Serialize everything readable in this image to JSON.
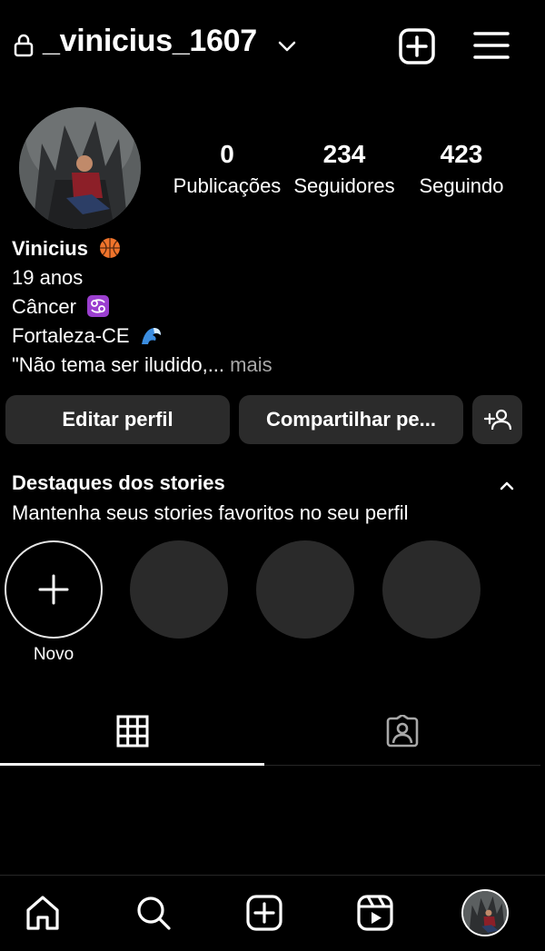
{
  "header": {
    "username": "_vinicius_1607",
    "icons": [
      "lock-icon",
      "chevron-down-icon",
      "create-post-icon",
      "menu-icon"
    ]
  },
  "stats": {
    "posts": {
      "count": "0",
      "label": "Publicações"
    },
    "followers": {
      "count": "234",
      "label": "Seguidores"
    },
    "following": {
      "count": "423",
      "label": "Seguindo"
    }
  },
  "bio": {
    "name": "Vinicius",
    "name_emoji": "basketball-icon",
    "lines": [
      "19 anos",
      "Câncer",
      "Fortaleza-CE"
    ],
    "line_emojis": [
      "",
      "cancer-zodiac-icon",
      "wave-icon"
    ],
    "quote": "\"Não tema ser iludido,...",
    "more": " mais"
  },
  "buttons": {
    "edit": "Editar perfil",
    "share": "Compartilhar pe...",
    "suggest_icon": "add-person-icon"
  },
  "highlights": {
    "title": "Destaques dos stories",
    "subtitle": "Mantenha seus stories favoritos no seu perfil",
    "new_label": "Novo"
  },
  "tabs": [
    {
      "icon": "grid-icon",
      "active": true
    },
    {
      "icon": "tagged-icon",
      "active": false
    }
  ],
  "nav": [
    "home-icon",
    "search-icon",
    "create-icon",
    "reels-icon",
    "profile-avatar"
  ]
}
